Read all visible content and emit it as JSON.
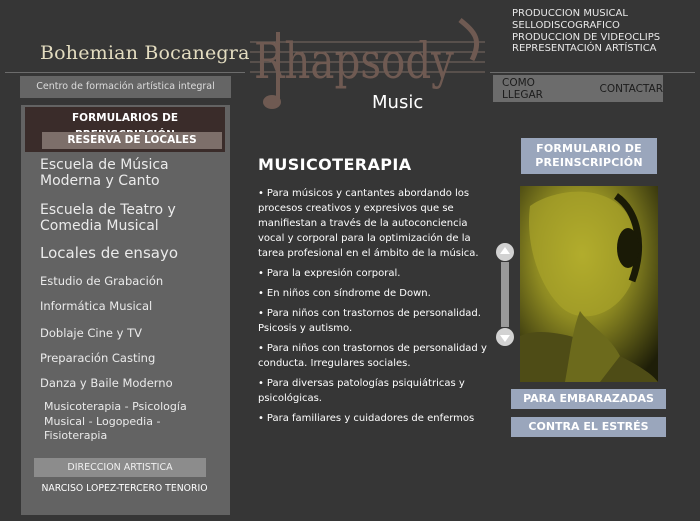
{
  "header": {
    "brand_name": "Bohemian Bocanegra",
    "subtitle": "Centro de formación artística integral",
    "logo_word": "Rhapsody",
    "logo_sub": "Music",
    "services": [
      "PRODUCCION MUSICAL",
      "SELLODISCOGRAFICO",
      "PRODUCCION DE VIDEOCLIPS",
      "REPRESENTACIÓN ARTÍSTICA"
    ],
    "nav": [
      "COMO LLEGAR",
      "CONTACTAR"
    ]
  },
  "sidebar": {
    "preinscription_label": "FORMULARIOS DE PREINSCRIPCIÓN",
    "reserve_label": "RESERVA DE LOCALES",
    "items": [
      "Escuela de Música Moderna y Canto",
      "Escuela de Teatro y Comedia Musical",
      "Locales de ensayo",
      "Estudio de Grabación",
      "Informática Musical",
      "Doblaje Cine y TV",
      "Preparación Casting",
      "Danza y Baile Moderno",
      "Musicoterapia - Psicología Musical - Logopedia - Fisioterapia"
    ],
    "direction_label": "DIRECCION ARTISTICA",
    "director_name": "NARCISO LOPEZ-TERCERO TENORIO"
  },
  "main": {
    "title": "MUSICOTERAPIA",
    "items": [
      "Para músicos y cantantes abordando los procesos creativos y expresivos que se manifiestan a través de la autoconciencia vocal y corporal para la optimización de la tarea profesional en el ámbito de la música.",
      "Para la expresión corporal.",
      "En niños con síndrome de Down.",
      "Para niños con trastornos de personalidad. Psicosis y autismo.",
      "Para niños con trastornos de personalidad y conducta. Irregulares sociales.",
      "Para diversas patologías psiquiátricas y psicológicas.",
      "Para familiares y cuidadores de enfermos"
    ],
    "bullet": "•"
  },
  "right": {
    "form_button": "FORMULARIO DE PREINSCRIPCIÓN",
    "pregnant_button": "PARA EMBARAZADAS",
    "stress_button": "CONTRA EL ESTRÉS"
  },
  "colors": {
    "background": "#363636",
    "sidebar": "#636363",
    "accent_blue": "#9aa6bc",
    "logo_brown": "#6f5a52"
  },
  "icons": {
    "scroll_up": "arrow-up-icon",
    "scroll_down": "arrow-down-icon",
    "logo_note": "music-note-icon"
  }
}
